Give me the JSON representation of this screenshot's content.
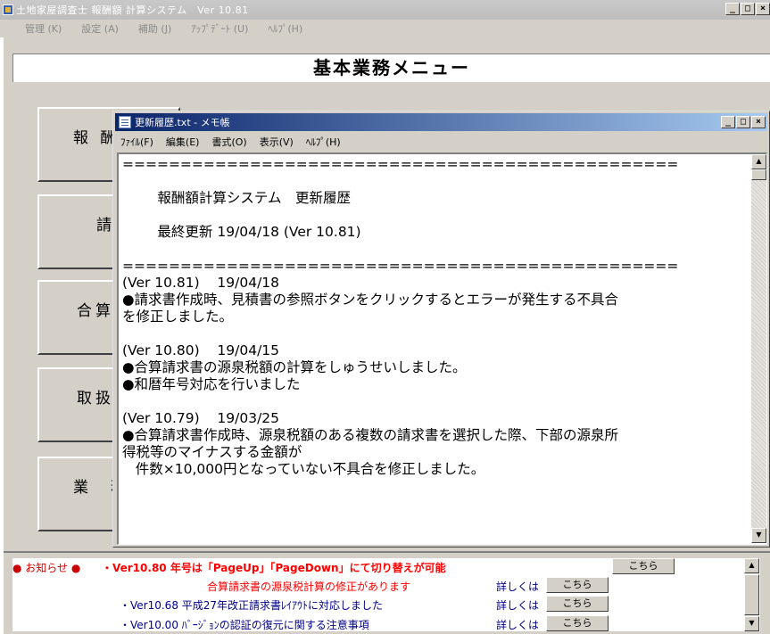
{
  "main_window": {
    "title": "土地家屋調査士 報酬額 計算システム　Ver 10.81",
    "controls": {
      "minimize": "_",
      "maximize": "□",
      "close": "×"
    },
    "menu": [
      "管理 (K)",
      "設定 (A)",
      "補助 (J)",
      "ｱｯﾌﾟﾃﾞｰﾄ (U)",
      "ﾍﾙﾌﾟ(H)"
    ],
    "header": "基本業務メニュー",
    "buttons": [
      "報 酬",
      "請",
      "合算",
      "取扱",
      "業　務"
    ]
  },
  "notepad": {
    "title": "更新履歴.txt - メモ帳",
    "controls": {
      "minimize": "_",
      "maximize": "□",
      "close": "×"
    },
    "menu": [
      "ﾌｧｲﾙ(F)",
      "編集(E)",
      "書式(O)",
      "表示(V)",
      "ﾍﾙﾌﾟ(H)"
    ],
    "content": "================================================\n\n        報酬額計算システム　更新履歴\n\n        最終更新 19/04/18 (Ver 10.81)\n\n================================================\n(Ver 10.81)    19/04/18\n●請求書作成時、見積書の参照ボタンをクリックするとエラーが発生する不具合\nを修正しました。\n\n(Ver 10.80)    19/04/15\n●合算請求書の源泉税額の計算をしゅうせいしました。\n●和暦年号対応を行いました\n\n(Ver 10.79)    19/03/25\n●合算請求書作成時、源泉税額のある複数の請求書を選択した際、下部の源泉所\n得税等のマイナスする金額が\n   件数×10,000円となっていない不具合を修正しました。"
  },
  "notice": {
    "label": "● お知らせ ●",
    "line1": "・Ver10.80 年号は「PageUp」「PageDown」にて切り替えが可能",
    "line2": "合算請求書の源泉税計算の修正があります",
    "line3": "・Ver10.68 平成27年改正請求書ﾚｲｱｳﾄに対応しました",
    "line4": "・Ver10.00 ﾊﾞｰｼﾞｮﾝの認証の復元に関する注意事項",
    "detail": "詳しくは",
    "button": "こちら"
  },
  "colors": {
    "notepad_title_start": "#0a246a",
    "notepad_title_end": "#a6caf0",
    "notice_red": "#ff0000",
    "notice_blue": "#00008b"
  }
}
